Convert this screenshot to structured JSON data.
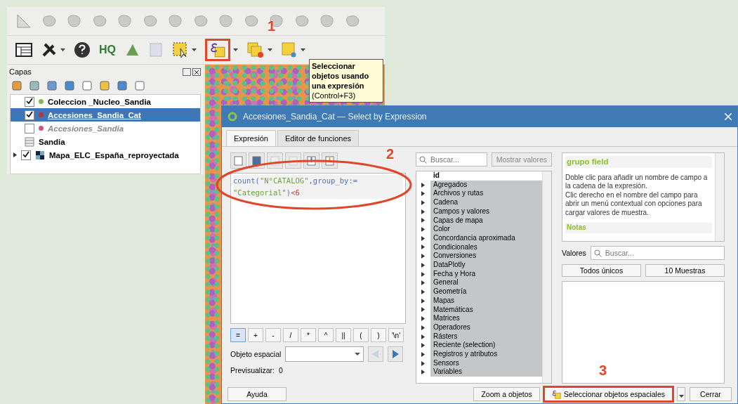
{
  "toolbar": {
    "plugin_label": "HQ"
  },
  "tooltip": {
    "title": "Seleccionar objetos usando una expresión",
    "shortcut": "(Control+F3)"
  },
  "layers_panel": {
    "title": "Capas",
    "layers": [
      {
        "name": "Coleccion _Nucleo_Sandia",
        "kind": "point",
        "checked": true,
        "selected": false,
        "color": "#7bbf4a"
      },
      {
        "name": "Accesiones_Sandia_Cat",
        "kind": "point",
        "checked": true,
        "selected": true,
        "color": "#c03040"
      },
      {
        "name": "Accesiones_Sandia",
        "kind": "point",
        "checked": false,
        "selected": false,
        "color": "#d0508a"
      },
      {
        "name": "Sandia",
        "kind": "table",
        "selected": false
      },
      {
        "name": "Mapa_ELC_España_reproyectada",
        "kind": "raster",
        "checked": true,
        "selected": false
      }
    ]
  },
  "dialog": {
    "title": "Accesiones_Sandia_Cat — Select by Expression",
    "tabs": [
      {
        "label": "Expresión",
        "selected": true
      },
      {
        "label": "Editor de funciones",
        "selected": false
      }
    ],
    "expression_lines": [
      [
        {
          "kind": "function",
          "text": "count("
        },
        {
          "kind": "string",
          "text": "\"N°CATALOG\""
        },
        {
          "kind": "function",
          "text": ",group_by:="
        }
      ],
      [
        {
          "kind": "string",
          "text": "\"Categorial\""
        },
        {
          "kind": "function",
          "text": ")"
        },
        {
          "kind": "number",
          "text": "<6"
        }
      ]
    ],
    "operators": [
      {
        "label": "=",
        "selected": true
      },
      {
        "label": "+",
        "selected": false
      },
      {
        "label": "-",
        "selected": false
      },
      {
        "label": "/",
        "selected": false
      },
      {
        "label": "*",
        "selected": false
      },
      {
        "label": "^",
        "selected": false
      },
      {
        "label": "||",
        "selected": false
      },
      {
        "label": "(",
        "selected": false
      },
      {
        "label": ")",
        "selected": false
      },
      {
        "label": "'\\n'",
        "selected": false
      }
    ],
    "spatial_object_label": "Objeto espacial",
    "preview_label": "Previsualizar:",
    "preview_value": "0",
    "function_search": {
      "placeholder": "Buscar..."
    },
    "show_values_button": "Mostrar valores",
    "function_field": "id",
    "function_groups": [
      "Agregados",
      "Archivos y rutas",
      "Cadena",
      "Campos y valores",
      "Capas de mapa",
      "Color",
      "Concordancia aproximada",
      "Condicionales",
      "Conversiones",
      "DataPlotly",
      "Fecha y Hora",
      "General",
      "Geometría",
      "Mapas",
      "Matemáticas",
      "Matrices",
      "Operadores",
      "Rásters",
      "Reciente (selection)",
      "Registros y atributos",
      "Sensors",
      "Variables"
    ],
    "help": {
      "title": "grupo field",
      "body": "Doble clic para añadir un nombre de campo a la cadena de la expresión.\nClic derecho en el nombre del campo para abrir un menú contextual con opciones para cargar valores de muestra.",
      "notes": "Notas"
    },
    "values": {
      "label": "Valores",
      "placeholder": "Buscar...",
      "buttons": [
        "Todos únicos",
        "10 Muestras"
      ]
    },
    "footer": {
      "help_button": "Ayuda",
      "zoom_button": "Zoom a objetos",
      "select_button": "Seleccionar objetos espaciales",
      "close_button": "Cerrar"
    }
  },
  "annotations": [
    "1",
    "2",
    "3"
  ]
}
